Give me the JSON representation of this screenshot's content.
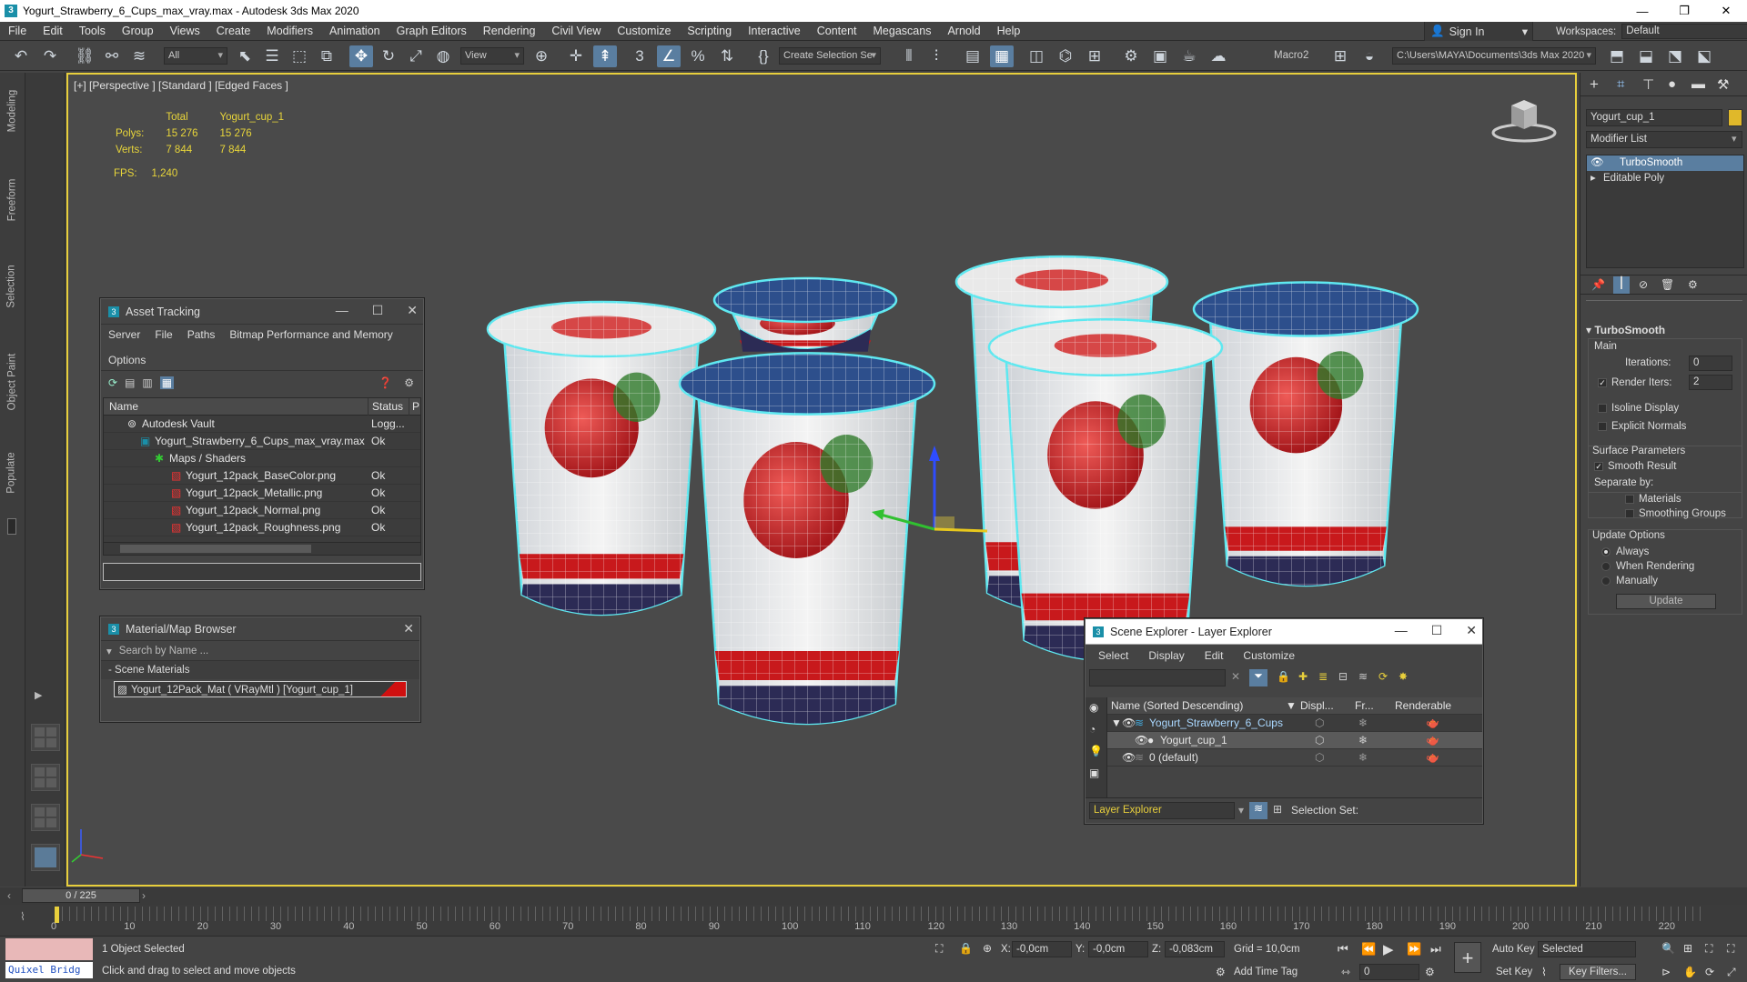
{
  "app": {
    "title": "Yogurt_Strawberry_6_Cups_max_vray.max - Autodesk 3ds Max 2020",
    "logo": "3"
  },
  "menu": [
    "File",
    "Edit",
    "Tools",
    "Group",
    "Views",
    "Create",
    "Modifiers",
    "Animation",
    "Graph Editors",
    "Rendering",
    "Civil View",
    "Customize",
    "Scripting",
    "Interactive",
    "Content",
    "Megascans",
    "Arnold",
    "Help"
  ],
  "signin": "Sign In",
  "workspace": {
    "label": "Workspaces:",
    "value": "Default"
  },
  "toolbar": {
    "filter": "All",
    "view": "View",
    "selset": "Create Selection Se",
    "macro": "Macro2",
    "path": "C:\\Users\\MAYA\\Documents\\3ds Max 2020"
  },
  "lefttabs": [
    "Modeling",
    "Freeform",
    "Selection",
    "Object Paint",
    "Populate"
  ],
  "viewport": {
    "label": "[+] [Perspective ] [Standard ] [Edged Faces ]",
    "stats": {
      "h1": "Total",
      "h2": "Yogurt_cup_1",
      "polys_l": "Polys:",
      "polys_t": "15 276",
      "polys_o": "15 276",
      "verts_l": "Verts:",
      "verts_t": "7 844",
      "verts_o": "7 844"
    },
    "fps_l": "FPS:",
    "fps": "1,240"
  },
  "asset": {
    "title": "Asset Tracking",
    "menu": [
      "Server",
      "File",
      "Paths",
      "Bitmap Performance and Memory",
      "Options"
    ],
    "cols": [
      "Name",
      "Status",
      "P"
    ],
    "rows": [
      {
        "name": "Autodesk Vault",
        "status": "Logg..."
      },
      {
        "name": "Yogurt_Strawberry_6_Cups_max_vray.max",
        "status": "Ok"
      },
      {
        "name": "Maps / Shaders",
        "status": ""
      },
      {
        "name": "Yogurt_12pack_BaseColor.png",
        "status": "Ok"
      },
      {
        "name": "Yogurt_12pack_Metallic.png",
        "status": "Ok"
      },
      {
        "name": "Yogurt_12pack_Normal.png",
        "status": "Ok"
      },
      {
        "name": "Yogurt_12pack_Roughness.png",
        "status": "Ok"
      }
    ]
  },
  "matbrowser": {
    "title": "Material/Map Browser",
    "search": "Search by Name ...",
    "section": "- Scene Materials",
    "item": "Yogurt_12Pack_Mat  ( VRayMtl )  [Yogurt_cup_1]"
  },
  "scene": {
    "title": "Scene Explorer - Layer Explorer",
    "menu": [
      "Select",
      "Display",
      "Edit",
      "Customize"
    ],
    "cols": [
      "Name (Sorted Descending)",
      "Displ...",
      "Fr...",
      "Renderable"
    ],
    "rows": [
      "Yogurt_Strawberry_6_Cups",
      "Yogurt_cup_1",
      "0 (default)"
    ],
    "footer": "Layer Explorer",
    "selset": "Selection Set:"
  },
  "cmd": {
    "objname": "Yogurt_cup_1",
    "modlist": "Modifier List",
    "stack": [
      "TurboSmooth",
      "Editable Poly"
    ],
    "rollout": "TurboSmooth",
    "main": "Main",
    "iter_l": "Iterations:",
    "iter": "0",
    "render_l": "Render Iters:",
    "render": "2",
    "isoline": "Isoline Display",
    "explicit": "Explicit Normals",
    "surf": "Surface Parameters",
    "smooth": "Smooth Result",
    "sep": "Separate by:",
    "mats": "Materials",
    "sg": "Smoothing Groups",
    "upd": "Update Options",
    "always": "Always",
    "whenr": "When Rendering",
    "manual": "Manually",
    "update": "Update"
  },
  "time": {
    "frame": "0 / 225",
    "ticks": [
      "0",
      "10",
      "20",
      "30",
      "40",
      "50",
      "60",
      "70",
      "80",
      "90",
      "100",
      "110",
      "120",
      "130",
      "140",
      "150",
      "160",
      "170",
      "180",
      "190",
      "200",
      "210",
      "220"
    ]
  },
  "status": {
    "quixel": "Quixel Bridg",
    "selected": "1 Object Selected",
    "hint": "Click and drag to select and move objects",
    "x_l": "X:",
    "x": "-0,0cm",
    "y_l": "Y:",
    "y": "-0,0cm",
    "z_l": "Z:",
    "z": "-0,083cm",
    "grid": "Grid = 10,0cm",
    "addtime": "Add Time Tag",
    "autokey": "Auto Key",
    "selected_dd": "Selected",
    "setkey": "Set Key",
    "keyfilters": "Key Filters...",
    "frame": "0"
  },
  "colors": {
    "accent": "#e8cf3c",
    "select": "#5a7ea0",
    "cyan": "#5ee8f0"
  }
}
